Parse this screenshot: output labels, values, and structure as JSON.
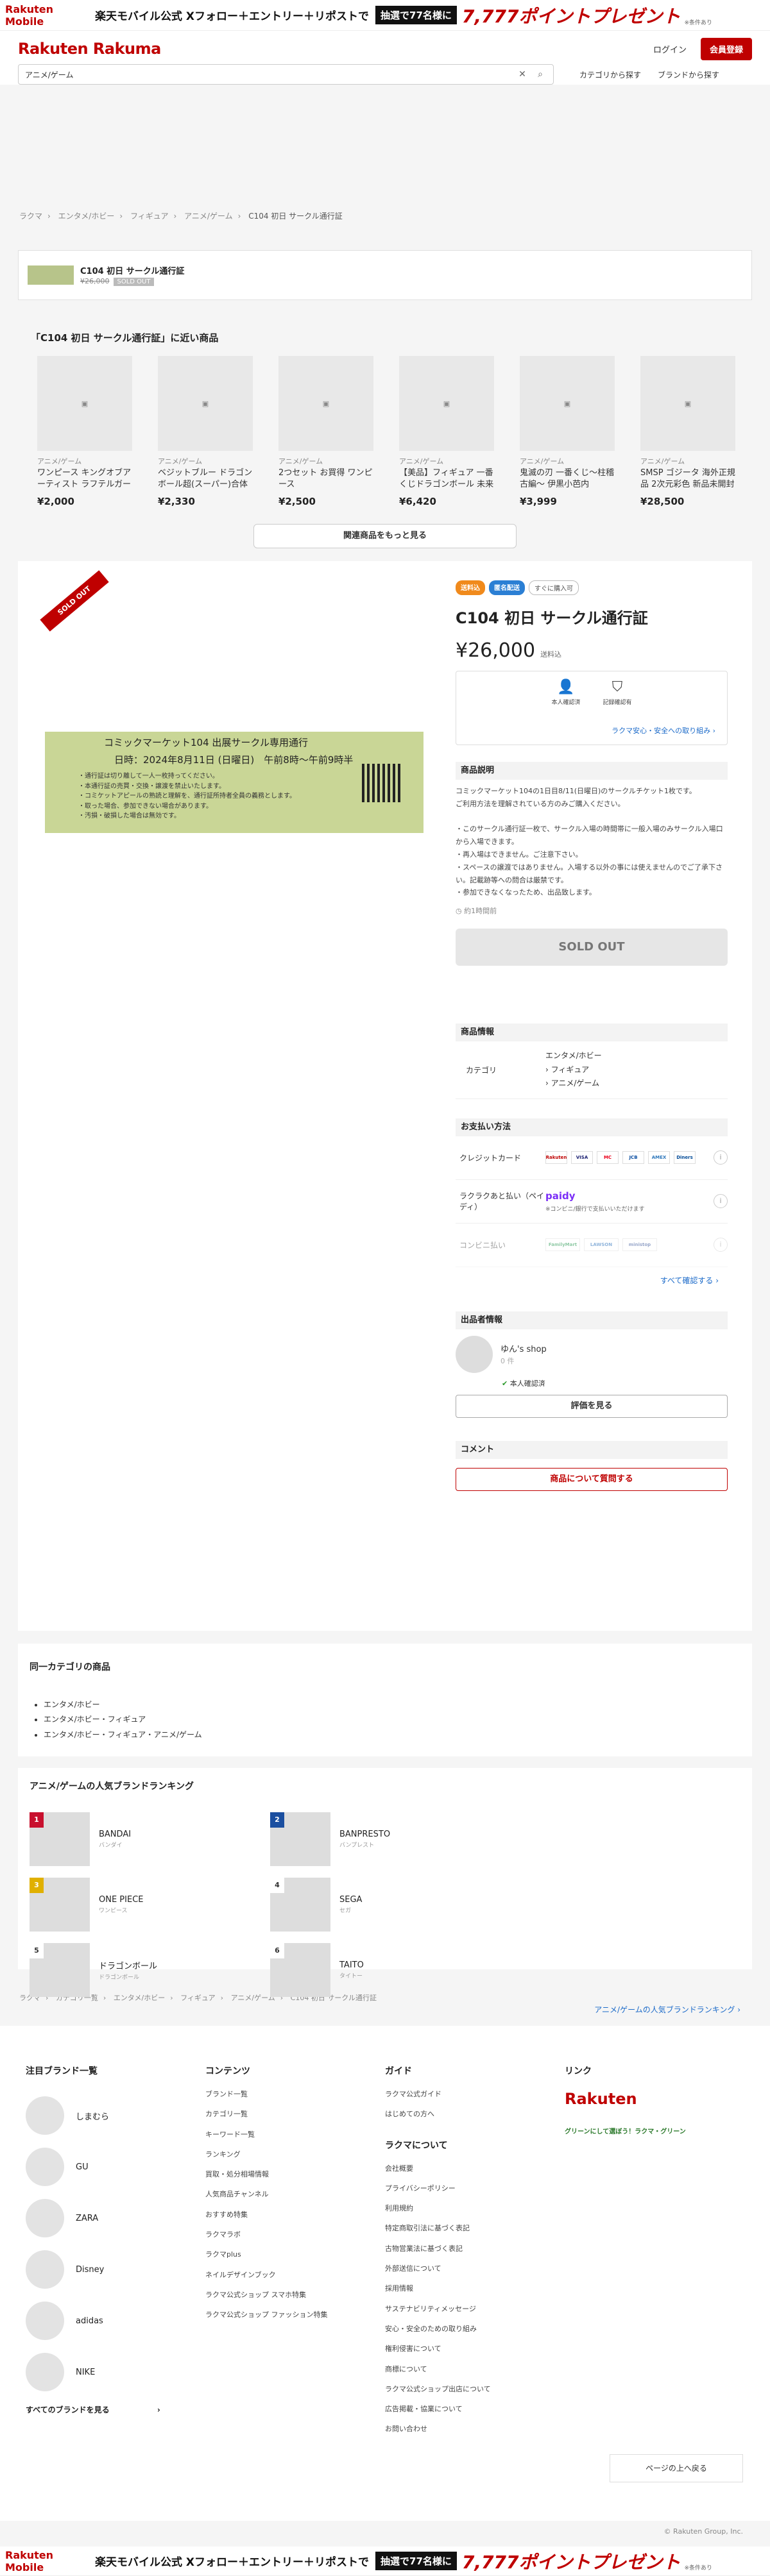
{
  "banner": {
    "left": "Rakuten Mobile",
    "text1": "楽天モバイル公式 Xフォロー＋エントリー＋リポストで",
    "text2": "抽選で77名様に",
    "text3": "7,777ポイントプレゼント",
    "text4": "※条件あり"
  },
  "header": {
    "logo": "Rakuten Rakuma",
    "login": "ログイン",
    "signup": "会員登録",
    "search_value": "アニメ/ゲーム",
    "find_category": "カテゴリから探す",
    "find_brand": "ブランドから探す"
  },
  "breadcrumb": [
    "ラクマ",
    "エンタメ/ホビー",
    "フィギュア",
    "アニメ/ゲーム",
    "C104 初日 サークル通行証"
  ],
  "mini": {
    "title": "C104 初日 サークル通行証",
    "price": "¥26,000",
    "status": "SOLD OUT"
  },
  "similar": {
    "heading": "「C104 初日 サークル通行証」に近い商品",
    "items": [
      {
        "cat": "アニメ/ゲーム",
        "name": "ワンピース キングオブアーティスト ラフテルガーロー",
        "price": "¥2,000"
      },
      {
        "cat": "アニメ/ゲーム",
        "name": "ベジットブルー ドラゴンボール超(スーパー)合体超戦士最強必...",
        "price": "¥2,330"
      },
      {
        "cat": "アニメ/ゲーム",
        "name": "2つセット お買得 ワンピース",
        "price": "¥2,500"
      },
      {
        "cat": "アニメ/ゲーム",
        "name": "【美品】フィギュア 一番くじドラゴンボール 未来への決闘 B...",
        "price": "¥6,420"
      },
      {
        "cat": "アニメ/ゲーム",
        "name": "鬼滅の刃 一番くじ〜柱稽古編〜 伊黒小芭内",
        "price": "¥3,999"
      },
      {
        "cat": "アニメ/ゲーム",
        "name": "SMSP ゴジータ 海外正規品 2次元彩色 新品未開封",
        "price": "¥28,500"
      }
    ],
    "more": "関連商品をもっと見る"
  },
  "product": {
    "sold_tag": "SOLD OUT",
    "ticket_line1": "コミックマーケット104 出展サークル専用通行",
    "ticket_line2": "日時：2024年8月11日 (日曜日)　午前8時〜午前9時半",
    "ticket_notes": [
      "・通行証は切り離して一人一枚持ってください。",
      "・本通行証の売買・交換・譲渡を禁止いたします。",
      "・コミケットアピールの熟読と理解を、通行証所持者全員の義務とします。",
      "・取った場合、参加できない場合があります。",
      "・汚損・破損した場合は無効です。"
    ],
    "badges": [
      "送料込",
      "匿名配送",
      "すぐに購入可"
    ],
    "title": "C104 初日 サークル通行証",
    "price": "¥26,000",
    "shipping": "送料込",
    "safe_items": [
      "本人確認済",
      "記録確認有"
    ],
    "safe_link": "ラクマ安心・安全への取り組み",
    "desc_head": "商品説明",
    "desc": "コミックマーケット104の1日目8/11(日曜日)のサークルチケット1枚です。\nご利用方法を理解されている方のみご購入ください。\n\n・このサークル通行証一枚で、サークル入場の時間帯に一般入場のみサークル入場口から入場できます。\n・再入場はできません。ご注意下さい。\n・スペースの譲渡ではありません。入場する以外の事には使えませんのでご了承下さい。記載跡等への問合は厳禁です。\n・参加できなくなったため、出品致します。",
    "ago": "約1時間前",
    "sold_button": "SOLD OUT",
    "info_head": "商品情報",
    "category_key": "カテゴリ",
    "category_vals": [
      "エンタメ/ホビー",
      "› フィギュア",
      "› アニメ/ゲーム"
    ],
    "pay_head": "お支払い方法",
    "pay": [
      {
        "name": "クレジットカード",
        "cards": [
          "Rakuten",
          "VISA",
          "MC",
          "JCB",
          "AMEX",
          "Diners"
        ]
      },
      {
        "name": "ラクラクあと払い（ペイディ）",
        "cards": [
          "paidy"
        ],
        "note": "※コンビニ/銀行で支払いいただけます"
      },
      {
        "name": "コンビニ払い",
        "cards": [
          "FamilyMart",
          "LAWSON",
          "ministop"
        ]
      }
    ],
    "see_all": "すべて確認する",
    "seller_head": "出品者情報",
    "seller_name": "ゆん's shop",
    "seller_id": "0 件",
    "verified": "本人確認済",
    "review_btn": "評価を見る",
    "comment_head": "コメント",
    "ask_btn": "商品について質問する"
  },
  "same_category": {
    "heading": "同一カテゴリの商品",
    "items": [
      "エンタメ/ホビー",
      "エンタメ/ホビー・フィギュア",
      "エンタメ/ホビー・フィギュア・アニメ/ゲーム"
    ]
  },
  "ranking": {
    "heading": "アニメ/ゲームの人気ブランドランキング",
    "items": [
      {
        "rank": "1",
        "name": "BANDAI",
        "sub": "バンダイ",
        "color": "#c8102e"
      },
      {
        "rank": "2",
        "name": "BANPRESTO",
        "sub": "バンプレスト",
        "color": "#1b4fa0"
      },
      {
        "rank": "3",
        "name": "ONE PIECE",
        "sub": "ワンピース",
        "color": "#e0b000"
      },
      {
        "rank": "4",
        "name": "SEGA",
        "sub": "セガ",
        "color": "#777777"
      },
      {
        "rank": "5",
        "name": "ドラゴンボール",
        "sub": "ドラゴンボール",
        "color": "#777777"
      },
      {
        "rank": "6",
        "name": "TAITO",
        "sub": "タイトー",
        "color": "#777777"
      }
    ],
    "more": "アニメ/ゲームの人気ブランドランキング"
  },
  "breadcrumb2": [
    "ラクマ",
    "カテゴリ一覧",
    "エンタメ/ホビー",
    "フィギュア",
    "アニメ/ゲーム",
    "C104 初日 サークル通行証"
  ],
  "footer": {
    "brands_head": "注目ブランド一覧",
    "brands": [
      "しまむら",
      "GU",
      "ZARA",
      "Disney",
      "adidas",
      "NIKE"
    ],
    "all_brands": "すべてのブランドを見る",
    "contents_head": "コンテンツ",
    "contents": [
      "ブランド一覧",
      "カテゴリ一覧",
      "キーワード一覧",
      "ランキング",
      "買取・処分相場情報",
      "人気商品チャンネル",
      "おすすめ特集",
      "ラクマラボ",
      "ラクマplus",
      "ネイルデザインブック",
      "ラクマ公式ショップ スマホ特集",
      "ラクマ公式ショップ ファッション特集"
    ],
    "guide_head": "ガイド",
    "guide": [
      "ラクマ公式ガイド",
      "はじめての方へ"
    ],
    "about_head": "ラクマについて",
    "about": [
      "会社概要",
      "プライバシーポリシー",
      "利用規約",
      "特定商取引法に基づく表記",
      "古物営業法に基づく表記",
      "外部送信について",
      "採用情報",
      "サステナビリティメッセージ",
      "安心・安全のための取り組み",
      "権利侵害について",
      "商標について",
      "ラクマ公式ショップ出店について",
      "広告掲載・協業について",
      "お問い合わせ"
    ],
    "links_head": "リンク",
    "rakuten": "Rakuten",
    "green": "グリーンにして選ぼう！ラクマ・グリーン",
    "to_top": "ページの上へ戻る",
    "copyright": "© Rakuten Group, Inc."
  }
}
